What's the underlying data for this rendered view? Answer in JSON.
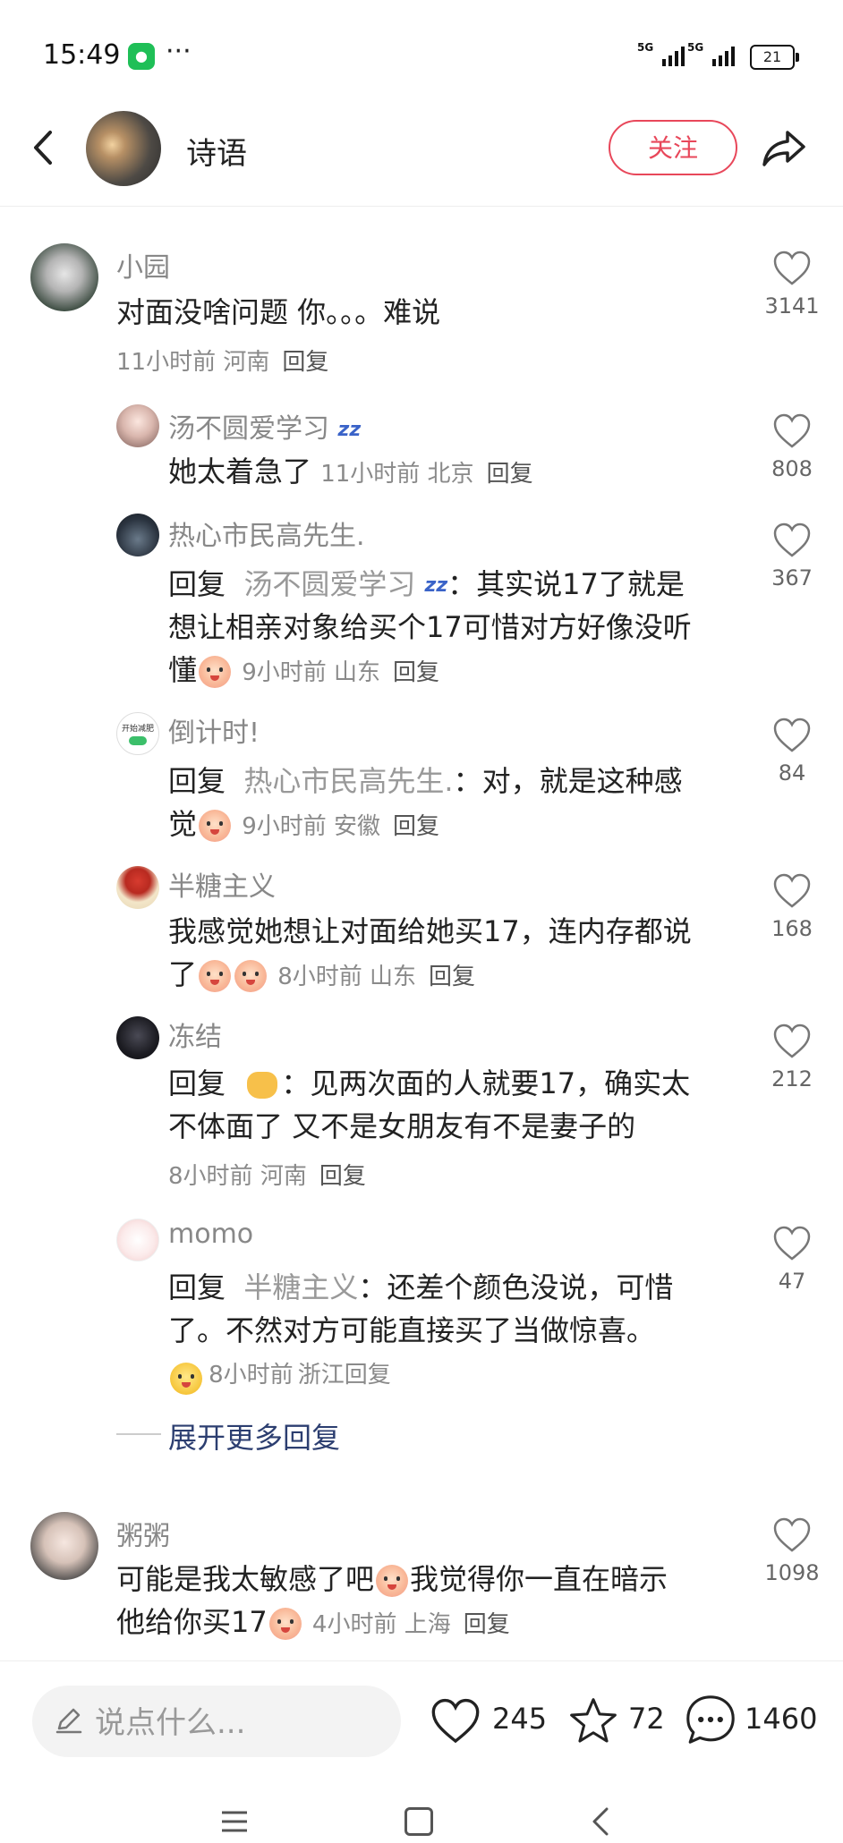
{
  "status_bar": {
    "time": "15:49",
    "dots": "···",
    "net1": "5G",
    "net2": "5G",
    "battery": "21"
  },
  "header": {
    "title": "诗语",
    "follow_label": "关注"
  },
  "comments": [
    {
      "user": "小园",
      "text": "对面没啥问题 你。。。难说",
      "time": "11小时前",
      "location": "河南",
      "reply_label": "回复",
      "likes": "3141"
    },
    {
      "user": "汤不圆爱学习",
      "text": "她太着急了",
      "time": "11小时前",
      "location": "北京",
      "reply_label": "回复",
      "likes": "808"
    },
    {
      "user": "热心市民高先生.",
      "reply_kw": "回复",
      "reply_to": "汤不圆爱学习",
      "text_a": "其实说17了就是",
      "text_b": "想让相亲对象给买个17可惜对方好像没听",
      "text_c": "懂",
      "time": "9小时前",
      "location": "山东",
      "reply_label": "回复",
      "likes": "367"
    },
    {
      "user": "倒计时!",
      "avatar_text": "开始减肥",
      "reply_kw": "回复",
      "reply_to": "热心市民高先生.",
      "text_a": "对，就是这种感",
      "text_b": "觉",
      "time": "9小时前",
      "location": "安徽",
      "reply_label": "回复",
      "likes": "84"
    },
    {
      "user": "半糖主义",
      "text_a": "我感觉她想让对面给她买17，连内存都说",
      "text_b": "了",
      "time": "8小时前",
      "location": "山东",
      "reply_label": "回复",
      "likes": "168"
    },
    {
      "user": "冻结",
      "reply_kw": "回复",
      "text_a": "见两次面的人就要17，确实太",
      "text_b": "不体面了 又不是女朋友有不是妻子的",
      "time": "8小时前",
      "location": "河南",
      "reply_label": "回复",
      "likes": "212"
    },
    {
      "user": "momo",
      "reply_kw": "回复",
      "reply_to": "半糖主义",
      "text_a": "还差个颜色没说，可惜",
      "text_b": "了。不然对方可能直接买了当做惊喜。",
      "time": "8小时前",
      "location": "浙江",
      "reply_label": "回复",
      "likes": "47"
    },
    {
      "user": "粥粥",
      "text_a": "可能是我太敏感了吧",
      "text_b": "我觉得你一直在暗示",
      "text_c": "他给你买17",
      "time": "4小时前",
      "location": "上海",
      "reply_label": "回复",
      "likes": "1098"
    }
  ],
  "expand_more": "展开更多回复",
  "bottom_bar": {
    "placeholder": "说点什么...",
    "likes": "245",
    "stars": "72",
    "comments": "1460"
  },
  "colors": {
    "accent": "#e8475a",
    "link": "#2c3e70",
    "muted": "#888888"
  }
}
